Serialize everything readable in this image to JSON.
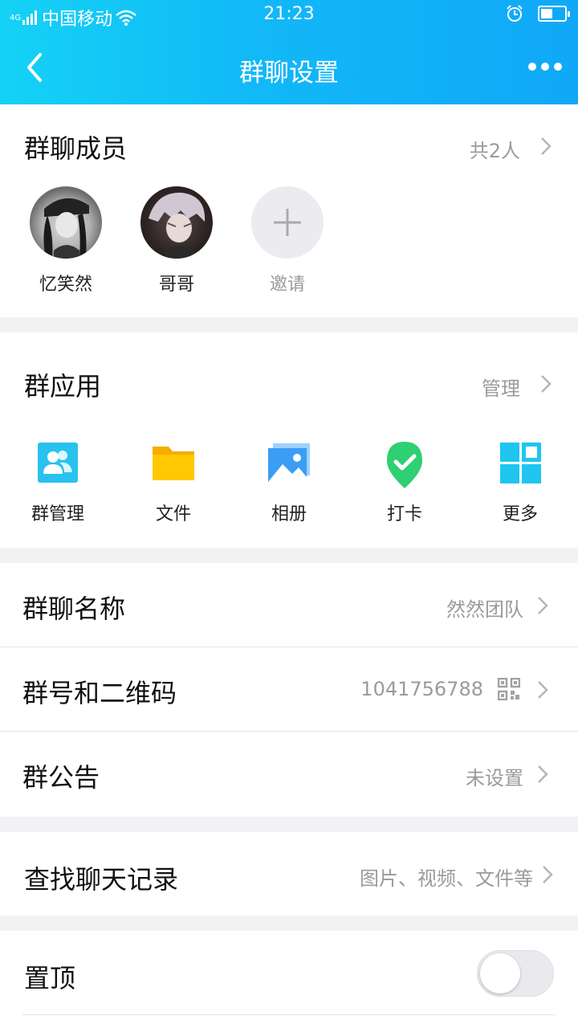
{
  "status_bar": {
    "network": "4G",
    "carrier": "中国移动",
    "time": "21:23",
    "battery_level": 0.45
  },
  "nav": {
    "title": "群聊设置",
    "back_icon": "chevron-left-icon",
    "more_icon": "more-dots-icon"
  },
  "members": {
    "title": "群聊成员",
    "count": "共2人",
    "list": [
      {
        "name": "忆笑然"
      },
      {
        "name": "哥哥"
      },
      {
        "name": "邀请"
      }
    ]
  },
  "apps": {
    "title": "群应用",
    "manage": "管理",
    "items": [
      {
        "label": "群管理",
        "icon": "group-manage-icon",
        "color": "#27c2ee"
      },
      {
        "label": "文件",
        "icon": "folder-icon",
        "color": "#ffc300"
      },
      {
        "label": "相册",
        "icon": "photo-album-icon",
        "color": "#3b9df4"
      },
      {
        "label": "打卡",
        "icon": "check-in-icon",
        "color": "#2fcf73"
      },
      {
        "label": "更多",
        "icon": "more-grid-icon",
        "color": "#1ec6f0"
      }
    ]
  },
  "settings": {
    "group_name": {
      "label": "群聊名称",
      "value": "然然团队"
    },
    "group_id": {
      "label": "群号和二维码",
      "value": "1041756788"
    },
    "notice": {
      "label": "群公告",
      "value": "未设置"
    },
    "search": {
      "label": "查找聊天记录",
      "value": "图片、视频、文件等"
    },
    "pin": {
      "label": "置顶",
      "enabled": false
    }
  },
  "colors": {
    "header_start": "#14d2f5",
    "header_end": "#10a8f7",
    "secondary_text": "#9a9a9f"
  }
}
